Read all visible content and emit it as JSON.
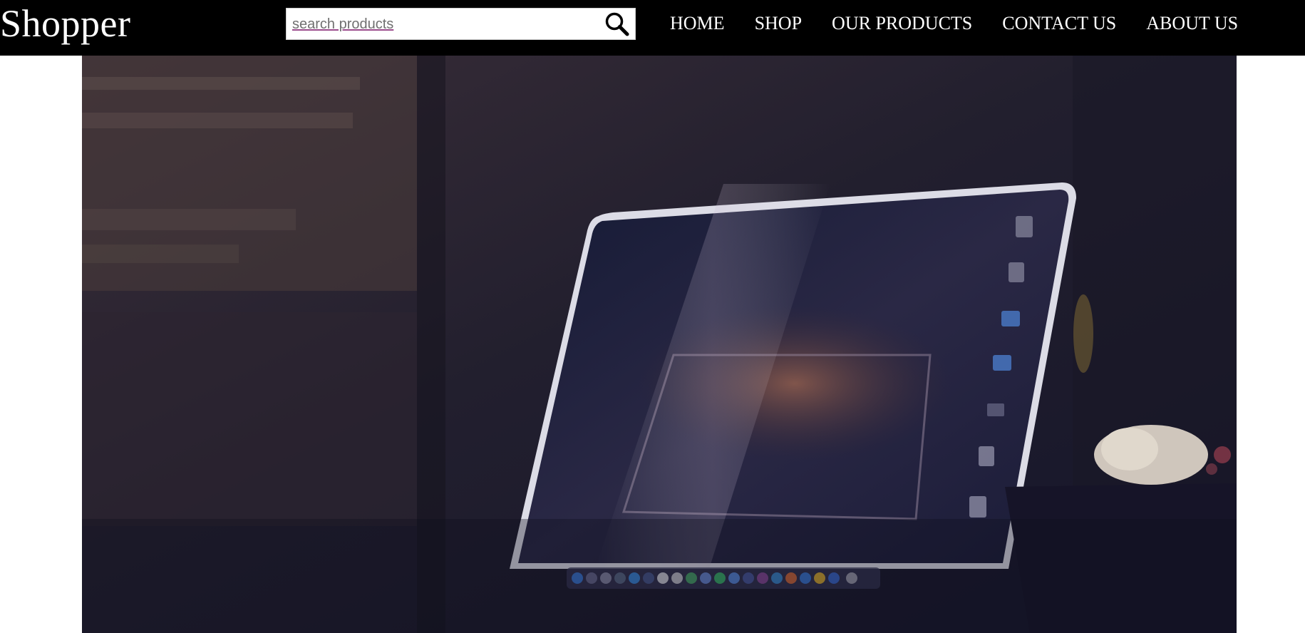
{
  "header": {
    "brand": "Shopper",
    "search": {
      "placeholder": "search products",
      "value": "",
      "icon": "search-icon"
    },
    "nav": [
      {
        "label": "HOME"
      },
      {
        "label": "SHOP"
      },
      {
        "label": "OUR PRODUCTS"
      },
      {
        "label": "CONTACT US"
      },
      {
        "label": "ABOUT US"
      }
    ]
  },
  "colors": {
    "navbar_bg": "#000000",
    "nav_text": "#ffffff",
    "page_bg": "#ffffff"
  },
  "hero": {
    "image": "laptop-photo"
  }
}
